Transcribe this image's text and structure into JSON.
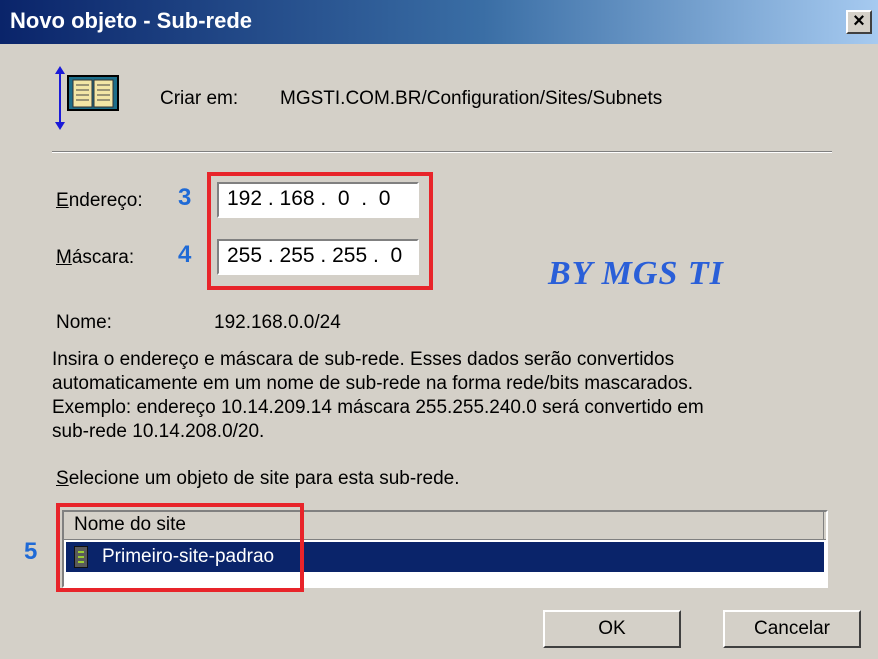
{
  "window": {
    "title": "Novo objeto - Sub-rede",
    "close_label": "×"
  },
  "header": {
    "create_in_label": "Criar em:",
    "create_in_path": "MGSTI.COM.BR/Configuration/Sites/Subnets"
  },
  "form": {
    "address_label_first": "E",
    "address_label_rest": "ndereço:",
    "address_value": "192 . 168 .  0  .  0",
    "mask_label_first": "M",
    "mask_label_rest": "áscara:",
    "mask_value": "255 . 255 . 255 .  0",
    "name_label": "Nome:",
    "name_value": "192.168.0.0/24"
  },
  "annotations": {
    "step_3": "3",
    "step_4": "4",
    "step_5": "5",
    "watermark": "BY MGS TI"
  },
  "description": {
    "line1": "Insira o endereço e máscara de sub-rede. Esses dados serão convertidos",
    "line2": "automaticamente em um nome de sub-rede na forma rede/bits mascarados.",
    "line3": "Exemplo: endereço 10.14.209.14 máscara 255.255.240.0 será convertido em",
    "line4": "sub-rede 10.14.208.0/20."
  },
  "site_select": {
    "prompt_first": "S",
    "prompt_rest": "elecione um objeto de site para esta sub-rede.",
    "column_header": "Nome do site",
    "rows": [
      {
        "name": "Primeiro-site-padrao",
        "selected": true
      }
    ]
  },
  "buttons": {
    "ok": "OK",
    "cancel": "Cancelar"
  },
  "colors": {
    "highlight_box": "#e8242a",
    "annotation_number": "#1f6ad6",
    "selection": "#0a246a",
    "dialog_face": "#d4d0c8"
  }
}
